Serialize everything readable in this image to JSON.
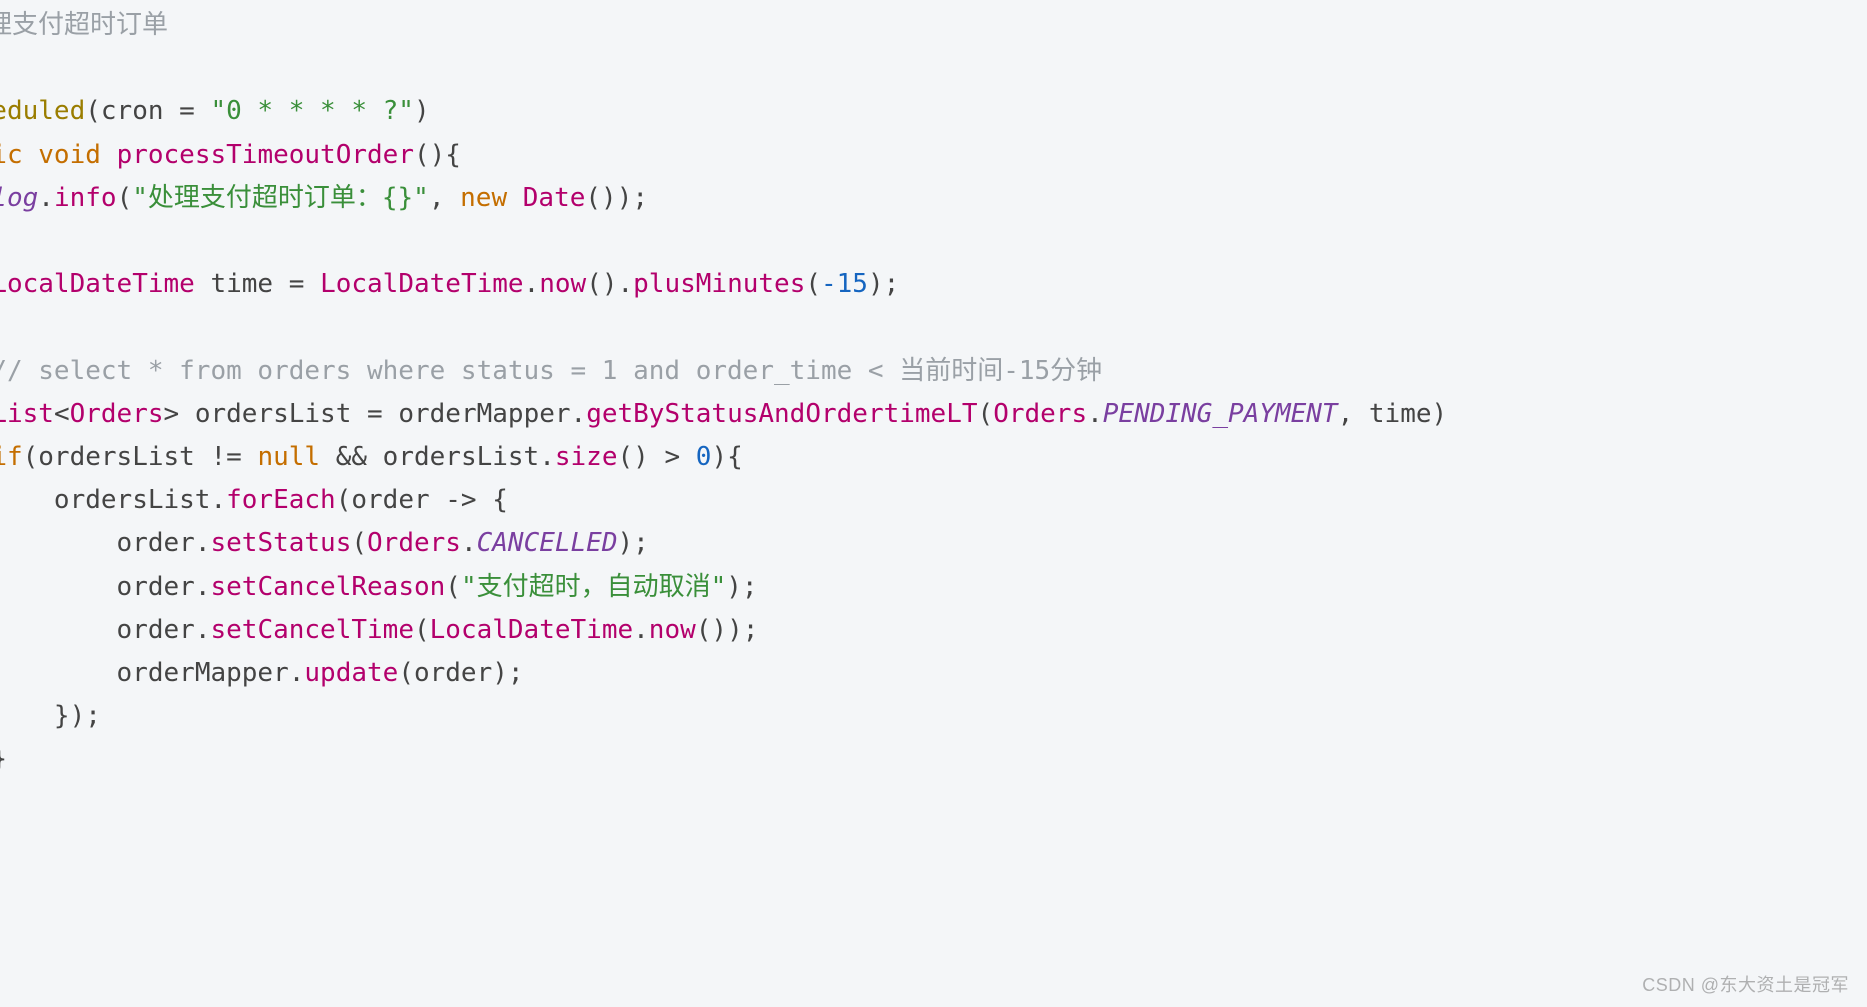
{
  "watermark": "CSDN @东大资土是冠军",
  "code": {
    "l1": {
      "comment": "处理支付超时订单"
    },
    "l2": {
      "comment": ""
    },
    "l3": {
      "ann": "cheduled",
      "p1": "(cron = ",
      "str": "\"0 * * * * ?\"",
      "p2": ")"
    },
    "l4": {
      "kw1": "blic",
      "kw2": "void",
      "fn": "processTimeoutOrder",
      "p": "(){"
    },
    "l5": {
      "ident": "log",
      "dot": ".",
      "mtd": "info",
      "p1": "(",
      "str": "\"处理支付超时订单：{}\"",
      "p2": ", ",
      "kw": "new",
      "type": "Date",
      "p3": "());"
    },
    "l6": {
      "type1": "LocalDateTime",
      "ident": "time",
      "eq": " = ",
      "type2": "LocalDateTime",
      "dot1": ".",
      "m1": "now",
      "p1": "().",
      "m2": "plusMinutes",
      "p2": "(",
      "num": "-15",
      "p3": ");"
    },
    "l7": {
      "comment": "// select * from orders where status = 1 and order_time < 当前时间-15分钟"
    },
    "l8": {
      "type1": "List",
      "lt": "<",
      "type2": "Orders",
      "gt": ">",
      "ident1": "ordersList",
      "eq": " = ",
      "ident2": "orderMapper",
      "dot": ".",
      "mtd": "getByStatusAndOrdertimeLT",
      "p1": "(",
      "type3": "Orders",
      "dot2": ".",
      "const": "PENDING_PAYMENT",
      "p2": ", time)"
    },
    "l9": {
      "kw": "if",
      "p1": "(ordersList != ",
      "null": "null",
      "p2": " && ordersList.",
      "mtd": "size",
      "p3": "() > ",
      "num": "0",
      "p4": "){"
    },
    "l10": {
      "ident": "ordersList",
      "dot": ".",
      "mtd": "forEach",
      "p": "(order -> {"
    },
    "l11": {
      "ident": "order",
      "dot": ".",
      "mtd": "setStatus",
      "p1": "(",
      "type": "Orders",
      "dot2": ".",
      "const": "CANCELLED",
      "p2": ");"
    },
    "l12": {
      "ident": "order",
      "dot": ".",
      "mtd": "setCancelReason",
      "p1": "(",
      "str": "\"支付超时，自动取消\"",
      "p2": ");"
    },
    "l13": {
      "ident": "order",
      "dot": ".",
      "mtd": "setCancelTime",
      "p1": "(",
      "type": "LocalDateTime",
      "dot2": ".",
      "m2": "now",
      "p2": "());"
    },
    "l14": {
      "ident": "orderMapper",
      "dot": ".",
      "mtd": "update",
      "p": "(order);"
    },
    "l15": {
      "p": "});"
    },
    "l16": {
      "p": "}"
    }
  }
}
